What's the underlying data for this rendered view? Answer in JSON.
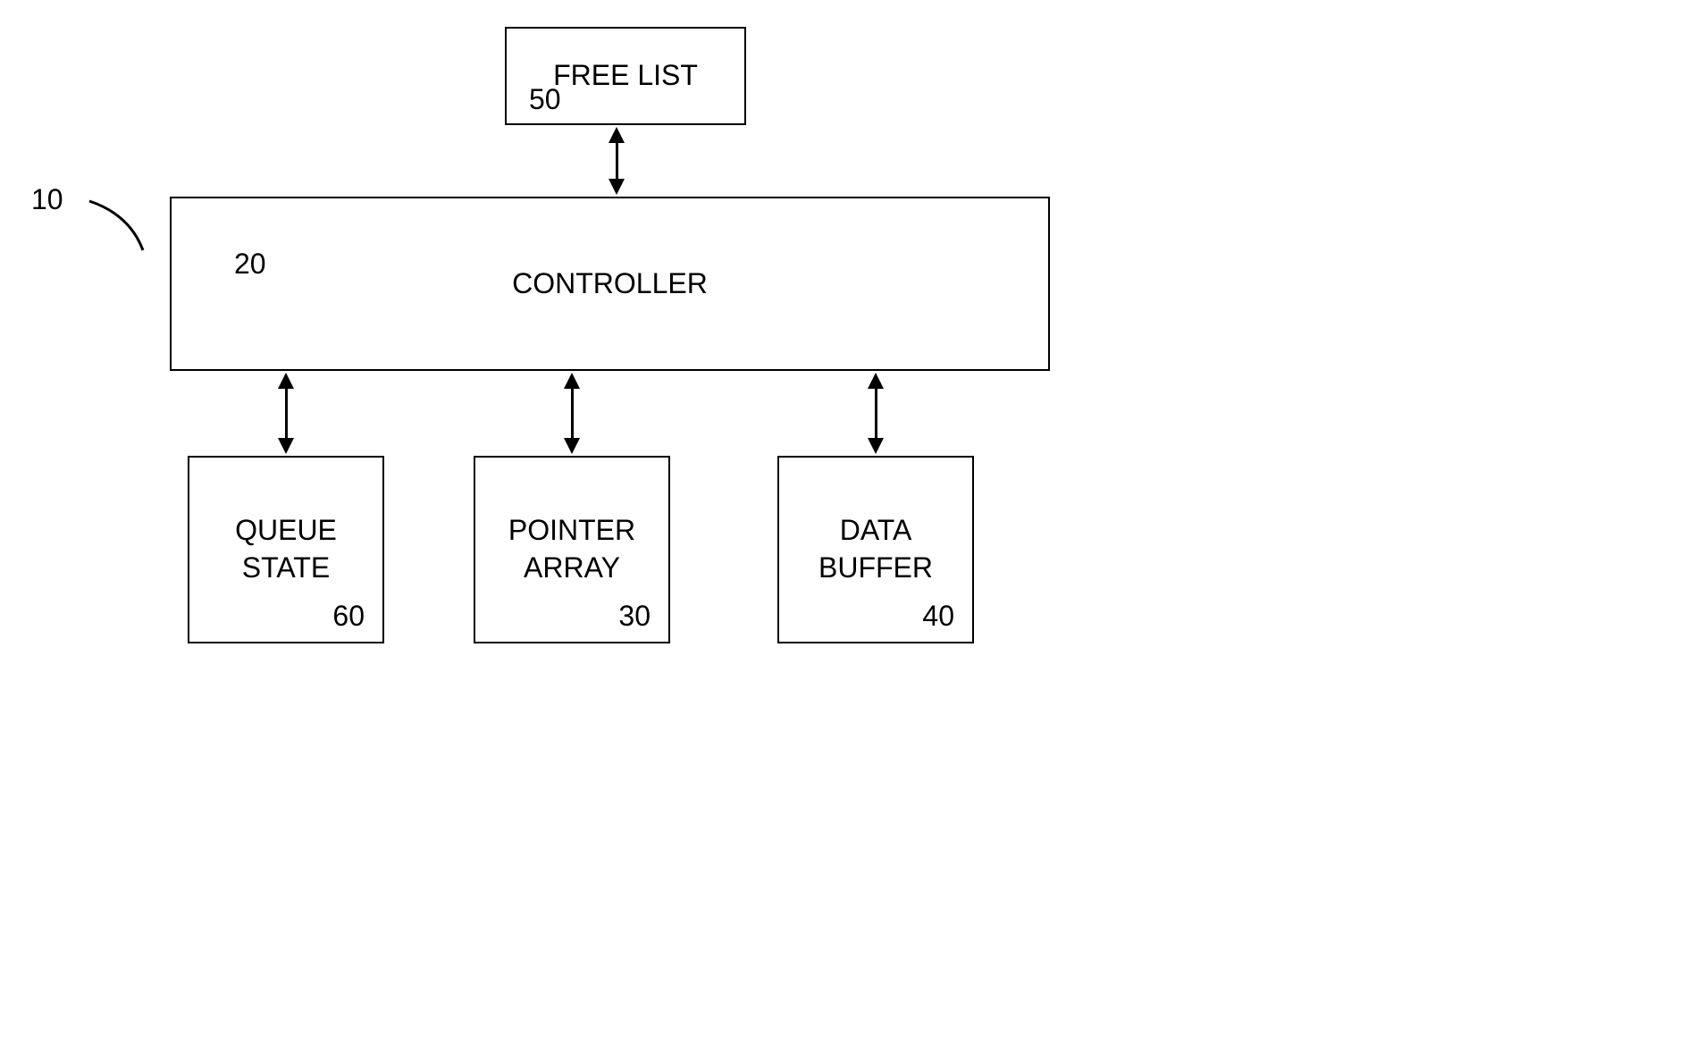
{
  "system_ref": "10",
  "boxes": {
    "free_list": {
      "label": "FREE LIST",
      "ref": "50"
    },
    "controller": {
      "label": "CONTROLLER",
      "ref": "20"
    },
    "queue_state": {
      "label": "QUEUE STATE",
      "ref": "60"
    },
    "pointer_array": {
      "label": "POINTER ARRAY",
      "ref": "30"
    },
    "data_buffer": {
      "label": "DATA BUFFER",
      "ref": "40"
    }
  }
}
